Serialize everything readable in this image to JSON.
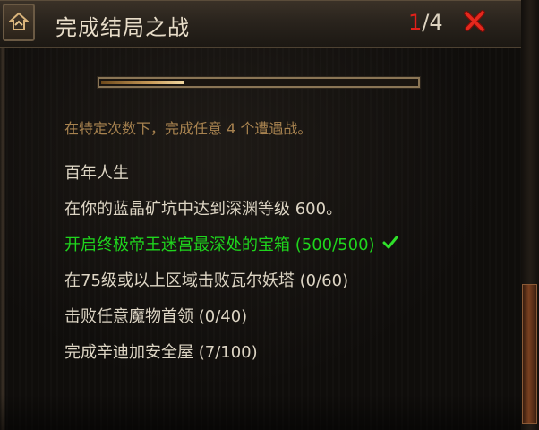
{
  "window": {
    "title": "完成结局之战",
    "counter_current": "1",
    "counter_total": "/4",
    "icon": "house-up-icon",
    "close_icon": "red-x-close-icon"
  },
  "progress": {
    "fraction": 0.26
  },
  "description": "在特定次数下，完成任意 4 个遭遇战。",
  "objectives": [
    {
      "label": "百年人生",
      "completed": false
    },
    {
      "label": "在你的蓝晶矿坑中达到深渊等级 600。",
      "completed": false
    },
    {
      "label": "开启终极帝王迷宫最深处的宝箱 (500/500)",
      "completed": true
    },
    {
      "label": "在75级或以上区域击败瓦尔妖塔 (0/60)",
      "completed": false
    },
    {
      "label": "击败任意魔物首领 (0/40)",
      "completed": false
    },
    {
      "label": "完成辛迪加安全屋 (7/100)",
      "completed": false
    }
  ],
  "colors": {
    "completed_text": "#1fd51d",
    "counter_current": "#e0201a",
    "description_text": "#a7824f"
  }
}
